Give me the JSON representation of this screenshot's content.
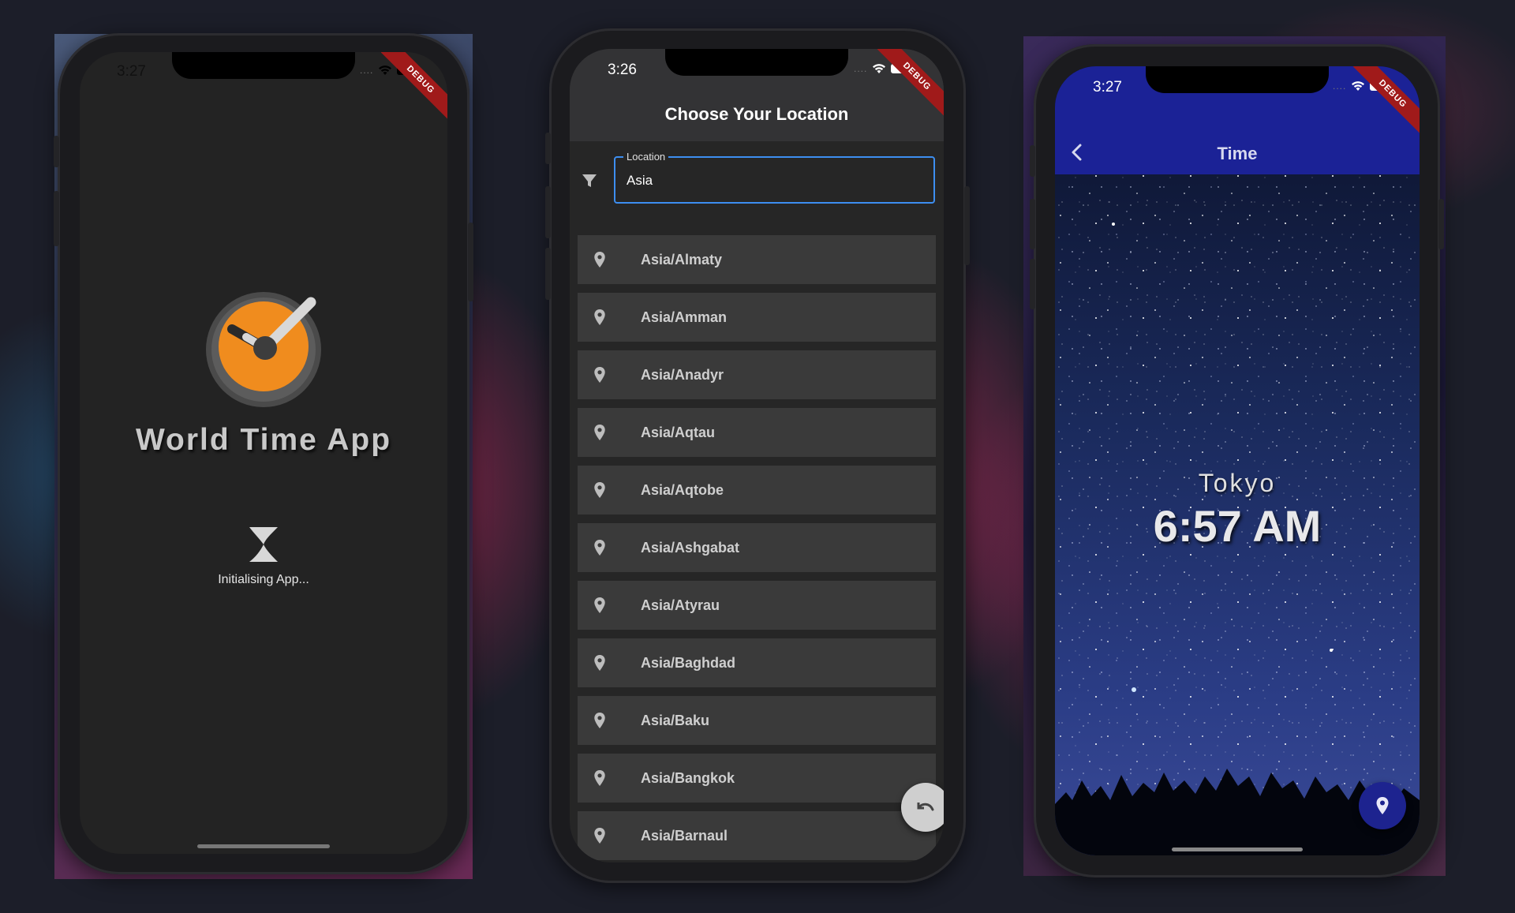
{
  "splash": {
    "status_time": "3:27",
    "debug": "DEBUG",
    "title": "World Time App",
    "loading_text": "Initialising App..."
  },
  "chooser": {
    "status_time": "3:26",
    "debug": "DEBUG",
    "title": "Choose Your Location",
    "field_label": "Location",
    "field_value": "Asia",
    "locations": [
      "Asia/Almaty",
      "Asia/Amman",
      "Asia/Anadyr",
      "Asia/Aqtau",
      "Asia/Aqtobe",
      "Asia/Ashgabat",
      "Asia/Atyrau",
      "Asia/Baghdad",
      "Asia/Baku",
      "Asia/Bangkok",
      "Asia/Barnaul"
    ]
  },
  "time_screen": {
    "status_time": "3:27",
    "debug": "DEBUG",
    "title": "Time",
    "city": "Tokyo",
    "time": "6:57 AM"
  },
  "colors": {
    "accent_blue": "#3d8ef0",
    "appbar_blue": "#1b2296",
    "logo_orange": "#f08c1e",
    "debug_red": "#a01a1a"
  }
}
